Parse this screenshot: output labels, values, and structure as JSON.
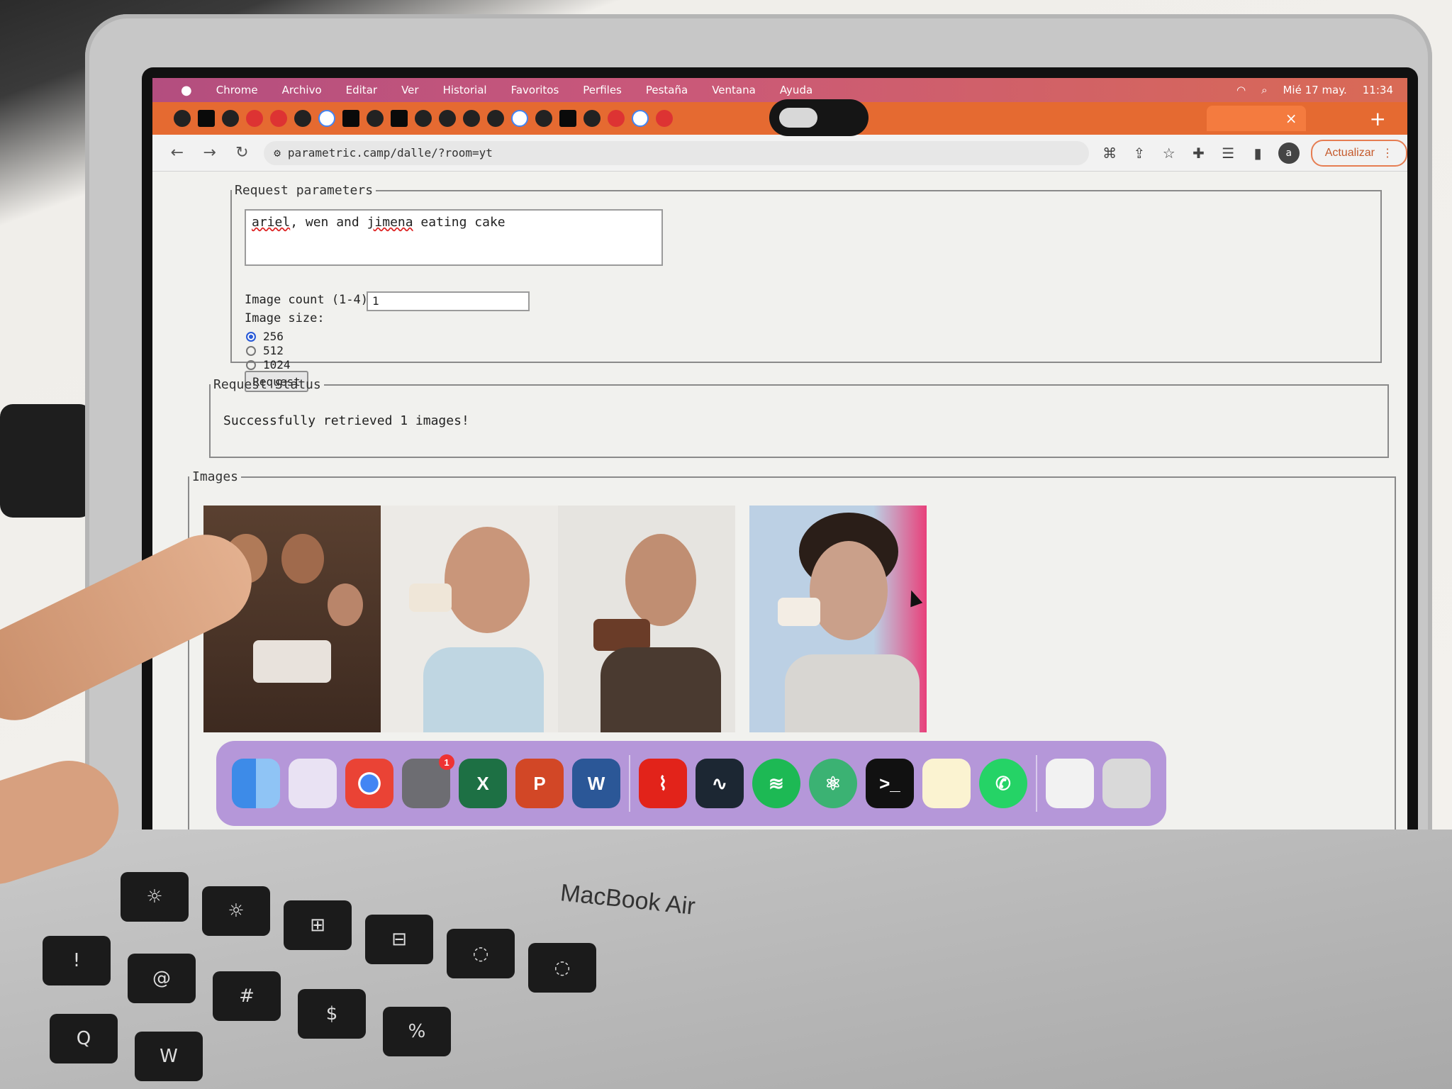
{
  "menubar": {
    "apple": "",
    "items": [
      "Chrome",
      "Archivo",
      "Editar",
      "Ver",
      "Historial",
      "Favoritos",
      "Perfiles",
      "Pestaña",
      "Ventana",
      "Ayuda"
    ],
    "date": "Mié 17 may.",
    "time": "11:34"
  },
  "browser": {
    "url": "parametric.camp/dalle/?room=yt",
    "active_tab_close": "×",
    "new_tab": "+",
    "update_label": "Actualizar",
    "profile_initial": "a",
    "accent_color": "#e56a31"
  },
  "params": {
    "legend": "Request parameters",
    "prompt_parts": [
      "ariel",
      ", wen and ",
      "jimena",
      " eating cake"
    ],
    "count_label": "Image count (1-4):",
    "count_value": "1",
    "size_label": "Image size:",
    "sizes": [
      "256",
      "512",
      "1024"
    ],
    "selected_size": "256",
    "request_label": "Request"
  },
  "status": {
    "legend": "Request Status",
    "message": "Successfully retrieved 1 images!"
  },
  "images": {
    "legend": "Images",
    "items": [
      "children-eating-cake",
      "man-eating-cake-side",
      "man-eating-cake-fork",
      "man-eating-cake-pink"
    ]
  },
  "dock": {
    "apps": [
      "finder-icon",
      "launchpad-icon",
      "chrome-icon",
      "system-settings-icon",
      "excel-icon",
      "powerpoint-icon",
      "word-icon",
      "acrobat-icon",
      "activity-monitor-icon",
      "spotify-icon",
      "atom-icon",
      "terminal-icon",
      "notes-icon",
      "whatsapp-icon",
      "document-icon",
      "trash-icon"
    ],
    "excel_letter": "X",
    "powerpoint_letter": "P",
    "word_letter": "W",
    "terminal_text": ">_",
    "settings_badge": "1"
  },
  "hardware": {
    "brand": "MacBook Air"
  }
}
